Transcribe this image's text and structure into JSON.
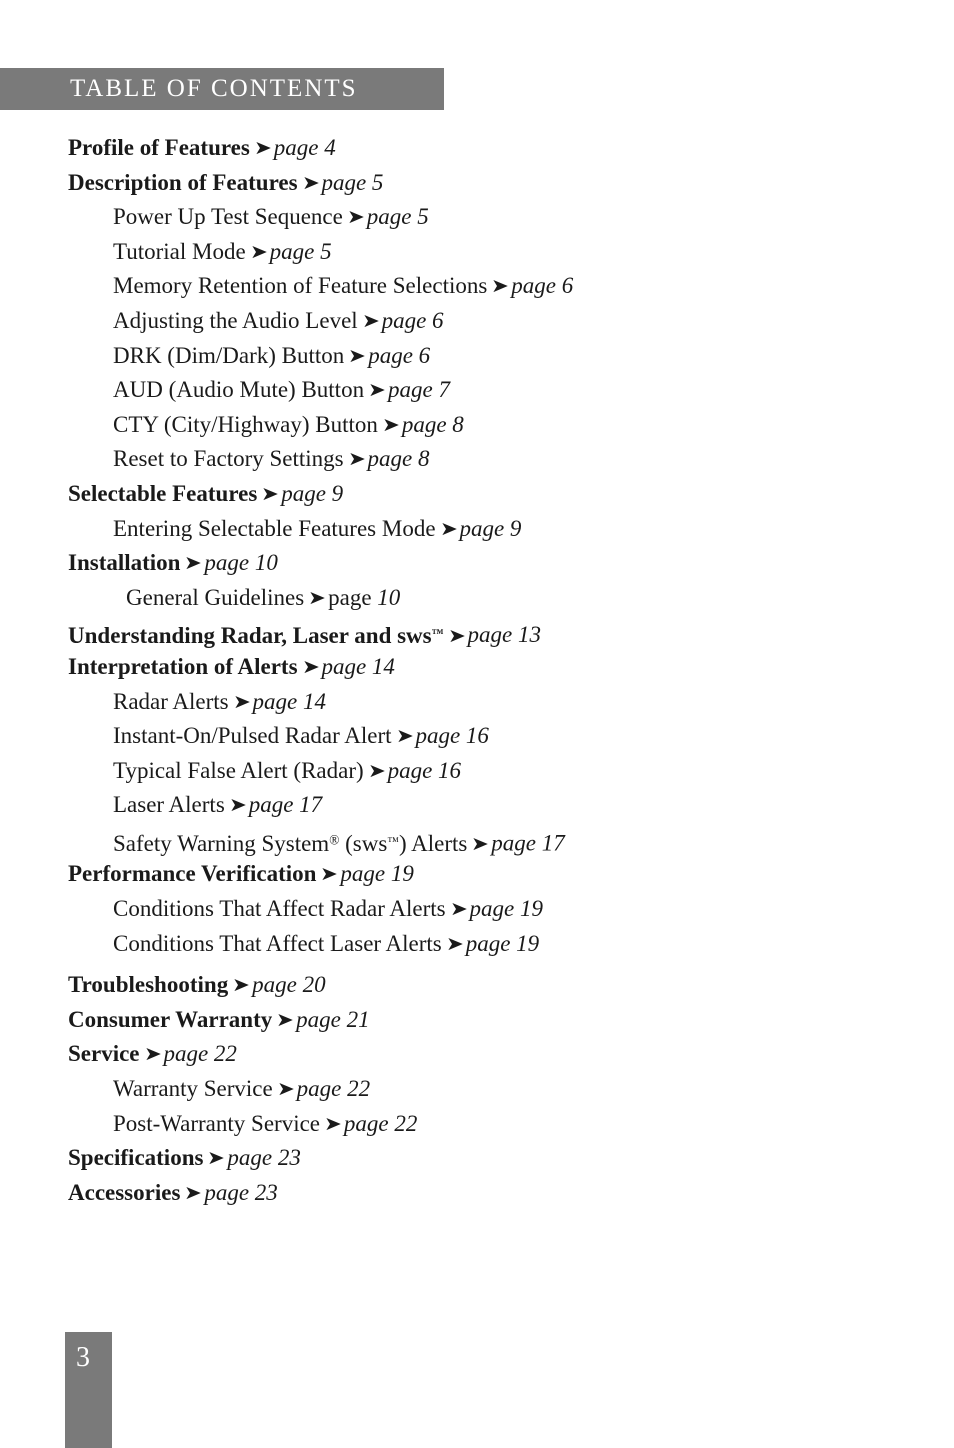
{
  "header": {
    "title": "TABLE OF CONTENTS",
    "band_color": "#7a7a7a",
    "text_color": "#ffffff"
  },
  "arrow_glyph": "➤",
  "toc": {
    "entries": [
      {
        "label": "Profile of Features",
        "page": "page 4",
        "level": 0
      },
      {
        "label": "Description of Features",
        "page": "page 5",
        "level": 0
      },
      {
        "label": "Power Up Test Sequence",
        "page": "page 5",
        "level": 1
      },
      {
        "label": "Tutorial Mode",
        "page": "page 5",
        "level": 1
      },
      {
        "label": "Memory Retention of Feature Selections",
        "page": "page 6",
        "level": 1
      },
      {
        "label": "Adjusting the Audio Level",
        "page": "page 6",
        "level": 1
      },
      {
        "label": "DRK (Dim/Dark) Button",
        "page": "page 6",
        "level": 1
      },
      {
        "label": "AUD (Audio Mute) Button",
        "page": "page 7",
        "level": 1
      },
      {
        "label": "CTY (City/Highway) Button",
        "page": "page 8",
        "level": 1
      },
      {
        "label": "Reset to Factory Settings",
        "page": "page 8",
        "level": 1
      },
      {
        "label": "Selectable Features",
        "page": "page 9",
        "level": 0
      },
      {
        "label": "Entering Selectable Features Mode",
        "page": "page 9",
        "level": 1
      },
      {
        "label": "Installation",
        "page": "page 10",
        "level": 0
      },
      {
        "label": "General Guidelines",
        "page_roman": "page ",
        "page_italic": "10",
        "level": 1
      },
      {
        "label_html": "Understanding Radar, Laser and sws<sup class=\"mark\">™</sup>",
        "label": "Understanding Radar, Laser and sws™",
        "page": "page 13",
        "level": 0
      },
      {
        "label": "Interpretation of Alerts",
        "page": "page 14",
        "level": 0
      },
      {
        "label": "Radar Alerts",
        "page": "page 14",
        "level": 1
      },
      {
        "label": "Instant-On/Pulsed Radar Alert",
        "page": "page 16",
        "level": 1
      },
      {
        "label": "Typical False Alert (Radar)",
        "page": "page 16",
        "level": 1
      },
      {
        "label": "Laser Alerts",
        "page": "page 17",
        "level": 1
      },
      {
        "label_html": "Safety Warning System<sup class=\"reg\">®</sup> (sws<sup class=\"mark\">™</sup>) Alerts",
        "label": "Safety Warning System® (sws™) Alerts",
        "page": "page 17",
        "level": 1
      },
      {
        "label": "Performance Verification",
        "page": "page 19",
        "level": 0
      },
      {
        "label": "Conditions That Affect Radar Alerts",
        "page": "page 19",
        "level": 1
      },
      {
        "label": "Conditions That Affect Laser Alerts",
        "page": "page 19",
        "level": 1
      },
      {
        "label": "Troubleshooting",
        "page": "page 20",
        "level": 0
      },
      {
        "label": "Consumer Warranty",
        "page": "page 21",
        "level": 0
      },
      {
        "label": "Service",
        "page": "page 22",
        "level": 0
      },
      {
        "label": "Warranty Service",
        "page": "page 22",
        "level": 1
      },
      {
        "label": "Post-Warranty Service",
        "page": "page 22",
        "level": 1
      },
      {
        "label": "Specifications",
        "page": "page 23",
        "level": 0
      },
      {
        "label": "Accessories",
        "page": "page 23",
        "level": 0
      }
    ]
  },
  "footer": {
    "page_number": "3",
    "band_color": "#7a7a7a",
    "text_color": "#ffffff"
  }
}
